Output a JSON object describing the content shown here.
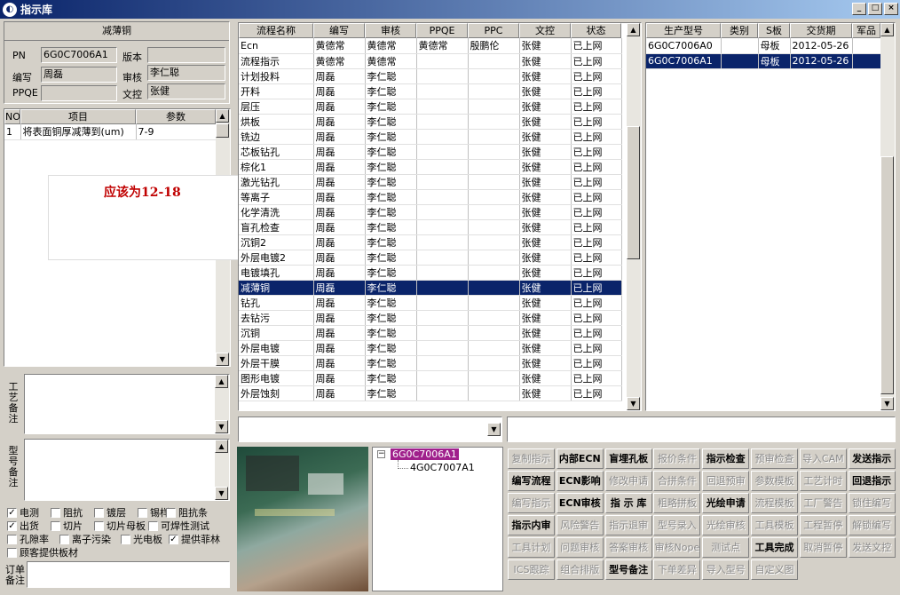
{
  "window": {
    "title": "指示库",
    "min": "_",
    "max": "□",
    "close": "×"
  },
  "left": {
    "header": "减薄铜",
    "fields": {
      "pn_label": "PN",
      "pn_value": "6G0C7006A1",
      "version_label": "版本",
      "version_value": "",
      "author_label": "编写",
      "author_value": "周磊",
      "review_label": "审核",
      "review_value": "李仁聪",
      "ppqe_label": "PPQE",
      "ppqe_value": "",
      "doc_label": "文控",
      "doc_value": "张健"
    },
    "params": {
      "headers": [
        "NO",
        "项目",
        "参数"
      ],
      "rows": [
        [
          "1",
          "将表面铜厚减薄到(um)",
          "7-9"
        ]
      ]
    },
    "annotation": "应该为12-18",
    "remark1_label": "工艺备注",
    "remark2_label": "型号备注",
    "order_label": "订单备注",
    "checkboxes": [
      {
        "label": "电测",
        "checked": true
      },
      {
        "label": "阻抗",
        "checked": false
      },
      {
        "label": "镀层",
        "checked": false
      },
      {
        "label": "锡样",
        "checked": false
      },
      {
        "label": "阻抗条",
        "checked": false
      },
      {
        "label": "出货",
        "checked": true
      },
      {
        "label": "切片",
        "checked": false
      },
      {
        "label": "切片母板",
        "checked": false
      },
      {
        "label": "可焊性测试",
        "checked": false
      },
      {
        "label": "孔隙率",
        "checked": false
      },
      {
        "label": "离子污染",
        "checked": false
      },
      {
        "label": "光电板",
        "checked": false
      },
      {
        "label": "提供菲林",
        "checked": true
      },
      {
        "label": "顾客提供板材",
        "checked": false
      }
    ]
  },
  "process": {
    "headers": [
      "流程名称",
      "编写",
      "审核",
      "PPQE",
      "PPC",
      "文控",
      "状态"
    ],
    "rows": [
      [
        "Ecn",
        "黄德常",
        "黄德常",
        "黄德常",
        "殷鹏伦",
        "张健",
        "已上网"
      ],
      [
        "流程指示",
        "黄德常",
        "黄德常",
        "",
        "",
        "张健",
        "已上网"
      ],
      [
        "计划投料",
        "周磊",
        "李仁聪",
        "",
        "",
        "张健",
        "已上网"
      ],
      [
        "开料",
        "周磊",
        "李仁聪",
        "",
        "",
        "张健",
        "已上网"
      ],
      [
        "层压",
        "周磊",
        "李仁聪",
        "",
        "",
        "张健",
        "已上网"
      ],
      [
        "烘板",
        "周磊",
        "李仁聪",
        "",
        "",
        "张健",
        "已上网"
      ],
      [
        "铣边",
        "周磊",
        "李仁聪",
        "",
        "",
        "张健",
        "已上网"
      ],
      [
        "芯板钻孔",
        "周磊",
        "李仁聪",
        "",
        "",
        "张健",
        "已上网"
      ],
      [
        "棕化1",
        "周磊",
        "李仁聪",
        "",
        "",
        "张健",
        "已上网"
      ],
      [
        "激光钻孔",
        "周磊",
        "李仁聪",
        "",
        "",
        "张健",
        "已上网"
      ],
      [
        "等离子",
        "周磊",
        "李仁聪",
        "",
        "",
        "张健",
        "已上网"
      ],
      [
        "化学清洗",
        "周磊",
        "李仁聪",
        "",
        "",
        "张健",
        "已上网"
      ],
      [
        "盲孔检查",
        "周磊",
        "李仁聪",
        "",
        "",
        "张健",
        "已上网"
      ],
      [
        "沉铜2",
        "周磊",
        "李仁聪",
        "",
        "",
        "张健",
        "已上网"
      ],
      [
        "外层电镀2",
        "周磊",
        "李仁聪",
        "",
        "",
        "张健",
        "已上网"
      ],
      [
        "电镀填孔",
        "周磊",
        "李仁聪",
        "",
        "",
        "张健",
        "已上网"
      ],
      [
        "减薄铜",
        "周磊",
        "李仁聪",
        "",
        "",
        "张健",
        "已上网"
      ],
      [
        "钻孔",
        "周磊",
        "李仁聪",
        "",
        "",
        "张健",
        "已上网"
      ],
      [
        "去钻污",
        "周磊",
        "李仁聪",
        "",
        "",
        "张健",
        "已上网"
      ],
      [
        "沉铜",
        "周磊",
        "李仁聪",
        "",
        "",
        "张健",
        "已上网"
      ],
      [
        "外层电镀",
        "周磊",
        "李仁聪",
        "",
        "",
        "张健",
        "已上网"
      ],
      [
        "外层干膜",
        "周磊",
        "李仁聪",
        "",
        "",
        "张健",
        "已上网"
      ],
      [
        "图形电镀",
        "周磊",
        "李仁聪",
        "",
        "",
        "张健",
        "已上网"
      ],
      [
        "外层蚀刻",
        "周磊",
        "李仁聪",
        "",
        "",
        "张健",
        "已上网"
      ]
    ],
    "selected": 16
  },
  "products": {
    "headers": [
      "生产型号",
      "类别",
      "S板",
      "交货期",
      "军品"
    ],
    "rows": [
      [
        "6G0C7006A0",
        "",
        "母板",
        "2012-05-26",
        ""
      ],
      [
        "6G0C7006A1",
        "",
        "母板",
        "2012-05-26",
        ""
      ]
    ],
    "selected": 1
  },
  "tree": {
    "root": "6G0C7006A1",
    "child": "4G0C7007A1"
  },
  "buttons": [
    {
      "label": "复制指示",
      "enabled": false
    },
    {
      "label": "内部ECN",
      "enabled": true
    },
    {
      "label": "盲埋孔板",
      "enabled": true
    },
    {
      "label": "报价条件",
      "enabled": false
    },
    {
      "label": "指示检查",
      "enabled": true
    },
    {
      "label": "预审检查",
      "enabled": false
    },
    {
      "label": "导入CAM",
      "enabled": false
    },
    {
      "label": "发送指示",
      "enabled": true
    },
    {
      "label": "编写流程",
      "enabled": true
    },
    {
      "label": "ECN影响",
      "enabled": true
    },
    {
      "label": "修改申请",
      "enabled": false
    },
    {
      "label": "合拼条件",
      "enabled": false
    },
    {
      "label": "回退预审",
      "enabled": false
    },
    {
      "label": "参数模板",
      "enabled": false
    },
    {
      "label": "工艺计时",
      "enabled": false
    },
    {
      "label": "回退指示",
      "enabled": true
    },
    {
      "label": "编写指示",
      "enabled": false
    },
    {
      "label": "ECN审核",
      "enabled": true
    },
    {
      "label": "指 示 库",
      "enabled": true
    },
    {
      "label": "粗略拼板",
      "enabled": false
    },
    {
      "label": "光绘申请",
      "enabled": true
    },
    {
      "label": "流程模板",
      "enabled": false
    },
    {
      "label": "工厂警告",
      "enabled": false
    },
    {
      "label": "锁住编写",
      "enabled": false
    },
    {
      "label": "指示内审",
      "enabled": true
    },
    {
      "label": "风险警告",
      "enabled": false
    },
    {
      "label": "指示退审",
      "enabled": false
    },
    {
      "label": "型号录入",
      "enabled": false
    },
    {
      "label": "光绘审核",
      "enabled": false
    },
    {
      "label": "工具模板",
      "enabled": false
    },
    {
      "label": "工程暂停",
      "enabled": false
    },
    {
      "label": "解锁编写",
      "enabled": false
    },
    {
      "label": "工具计划",
      "enabled": false
    },
    {
      "label": "问题审核",
      "enabled": false
    },
    {
      "label": "答案审核",
      "enabled": false
    },
    {
      "label": "审核Nope",
      "enabled": false
    },
    {
      "label": "测试点",
      "enabled": false
    },
    {
      "label": "工具完成",
      "enabled": true
    },
    {
      "label": "取消暂停",
      "enabled": false
    },
    {
      "label": "发送文控",
      "enabled": false
    },
    {
      "label": "ICS跟踪",
      "enabled": false
    },
    {
      "label": "组合排版",
      "enabled": false
    },
    {
      "label": "型号备注",
      "enabled": true
    },
    {
      "label": "下单差异",
      "enabled": false
    },
    {
      "label": "导入型号",
      "enabled": false
    },
    {
      "label": "自定义图",
      "enabled": false
    }
  ],
  "colors": {
    "selection": "#0a246a",
    "annotation": "#c00000",
    "tree_highlight": "#a0208c"
  }
}
